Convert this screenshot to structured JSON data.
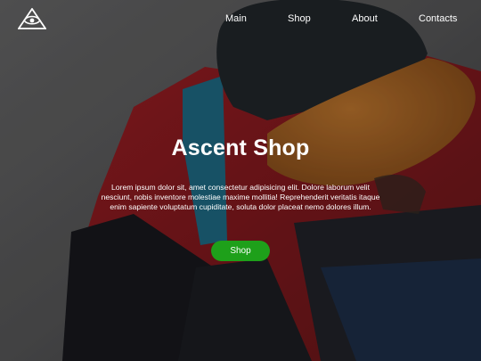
{
  "nav": {
    "items": [
      {
        "label": "Main"
      },
      {
        "label": "Shop"
      },
      {
        "label": "About"
      },
      {
        "label": "Contacts"
      }
    ]
  },
  "hero": {
    "title": "Ascent Shop",
    "description": "Lorem ipsum dolor sit, amet consectetur adipisicing elit. Dolore laborum velit nesciunt, nobis inventore molestiae maxime mollitia! Reprehenderit veritatis itaque enim sapiente voluptatum cupiditate, soluta dolor placeat nemo dolores illum.",
    "cta_label": "Shop",
    "cta_color": "#1ea01a",
    "logo_icon": "triangle-eye-icon"
  }
}
